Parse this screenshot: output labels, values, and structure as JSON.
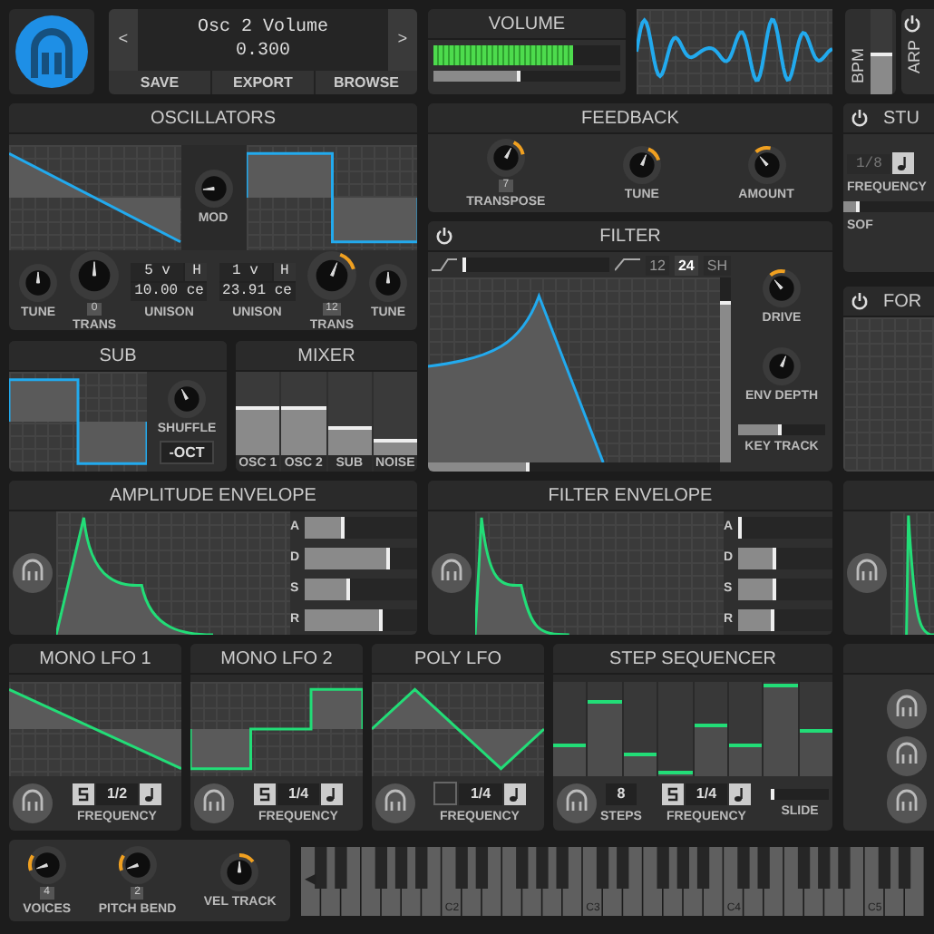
{
  "preset": {
    "prev": "<",
    "name": "Osc 2 Volume",
    "value": "0.300",
    "next": ">",
    "buttons": [
      "SAVE",
      "EXPORT",
      "BROWSE"
    ]
  },
  "volume": {
    "title": "VOLUME",
    "meter": {
      "level": 0.75
    },
    "slider": {
      "level": 0.47
    }
  },
  "bpm": {
    "label": "BPM",
    "level": 0.45
  },
  "arp": {
    "label": "ARP"
  },
  "oscillators": {
    "title": "OSCILLATORS",
    "mod": {
      "label": "MOD",
      "level": 0.15
    },
    "controls": [
      {
        "kind": "knob",
        "label": "TUNE",
        "level": 0.5
      },
      {
        "kind": "large_knob",
        "label": "TRANS",
        "level": 0.5,
        "badge": "0"
      },
      {
        "kind": "unison",
        "label": "UNISON",
        "voices": "5 v",
        "mode": "H",
        "detune": "10.00 ce"
      },
      {
        "kind": "unison",
        "label": "UNISON",
        "voices": "1 v",
        "mode": "H",
        "detune": "23.91 ce"
      },
      {
        "kind": "large_knob",
        "label": "TRANS",
        "level": 0.58,
        "badge": "12",
        "modulated": true
      },
      {
        "kind": "knob",
        "label": "TUNE",
        "level": 0.5
      }
    ]
  },
  "sub": {
    "title": "SUB",
    "shuffle": {
      "label": "SHUFFLE",
      "level": 0.4
    },
    "octave": "-OCT"
  },
  "mixer": {
    "title": "MIXER",
    "channels": [
      {
        "label": "OSC 1",
        "level": 0.55
      },
      {
        "label": "OSC 2",
        "level": 0.55
      },
      {
        "label": "SUB",
        "level": 0.3
      },
      {
        "label": "NOISE",
        "level": 0.15
      }
    ]
  },
  "feedback": {
    "title": "FEEDBACK",
    "knobs": [
      {
        "label": "TRANSPOSE",
        "level": 0.6,
        "badge": "7",
        "modulated": true
      },
      {
        "label": "TUNE",
        "level": 0.58,
        "modulated": true
      },
      {
        "label": "AMOUNT",
        "level": 0.35,
        "modulated": true
      }
    ]
  },
  "filter": {
    "title": "FILTER",
    "blend": {
      "level": 0.01
    },
    "slopes": [
      {
        "label": "12",
        "selected": false
      },
      {
        "label": "24",
        "selected": true
      },
      {
        "label": "SH",
        "selected": false
      }
    ],
    "resonance": {
      "level": 0.85
    },
    "cutoff": {
      "level": 0.35
    },
    "knobs": [
      {
        "label": "DRIVE",
        "level": 0.35,
        "modulated": true
      },
      {
        "label": "ENV DEPTH",
        "level": 0.58
      }
    ],
    "key_track": {
      "label": "KEY TRACK",
      "level": 0.5
    }
  },
  "stutter": {
    "title": "STU",
    "frequency": "1/8",
    "frequency_label": "FREQUENCY",
    "softness": {
      "level": 0.15
    },
    "softness_label": "SOF"
  },
  "formant": {
    "title": "FOR"
  },
  "amp_envelope": {
    "title": "AMPLITUDE ENVELOPE",
    "stages": [
      {
        "label": "A",
        "level": 0.35
      },
      {
        "label": "D",
        "level": 0.75
      },
      {
        "label": "S",
        "level": 0.4
      },
      {
        "label": "R",
        "level": 0.7
      }
    ]
  },
  "filter_envelope": {
    "title": "FILTER ENVELOPE",
    "stages": [
      {
        "label": "A",
        "level": 0.02
      },
      {
        "label": "D",
        "level": 0.4
      },
      {
        "label": "S",
        "level": 0.4
      },
      {
        "label": "R",
        "level": 0.38
      }
    ]
  },
  "lfos": [
    {
      "title": "MONO LFO 1",
      "synced": true,
      "frequency": "1/2",
      "frequency_label": "FREQUENCY"
    },
    {
      "title": "MONO LFO 2",
      "synced": true,
      "frequency": "1/4",
      "frequency_label": "FREQUENCY"
    },
    {
      "title": "POLY LFO",
      "synced": false,
      "frequency": "1/4",
      "frequency_label": "FREQUENCY"
    }
  ],
  "step_sequencer": {
    "title": "STEP SEQUENCER",
    "steps": [
      {
        "level": 0.35
      },
      {
        "level": 0.8
      },
      {
        "level": 0.25
      },
      {
        "level": 0.05
      },
      {
        "level": 0.55
      },
      {
        "level": 0.35
      },
      {
        "level": 0.98
      },
      {
        "level": 0.5
      }
    ],
    "num_steps": "8",
    "steps_label": "STEPS",
    "synced": true,
    "frequency": "1/4",
    "frequency_label": "FREQUENCY",
    "slide": {
      "level": 0.03
    },
    "slide_label": "SLIDE"
  },
  "voice_controls": [
    {
      "label": "VOICES",
      "level": 0.1,
      "badge": "4",
      "modulated": true
    },
    {
      "label": "PITCH BEND",
      "level": 0.1,
      "badge": "2",
      "modulated": true
    },
    {
      "label": "VEL TRACK",
      "level": 0.5,
      "modulated": true
    }
  ],
  "keyboard": {
    "scroll": "◀",
    "octave_labels": [
      "C2",
      "C3",
      "C4",
      "C5"
    ]
  }
}
